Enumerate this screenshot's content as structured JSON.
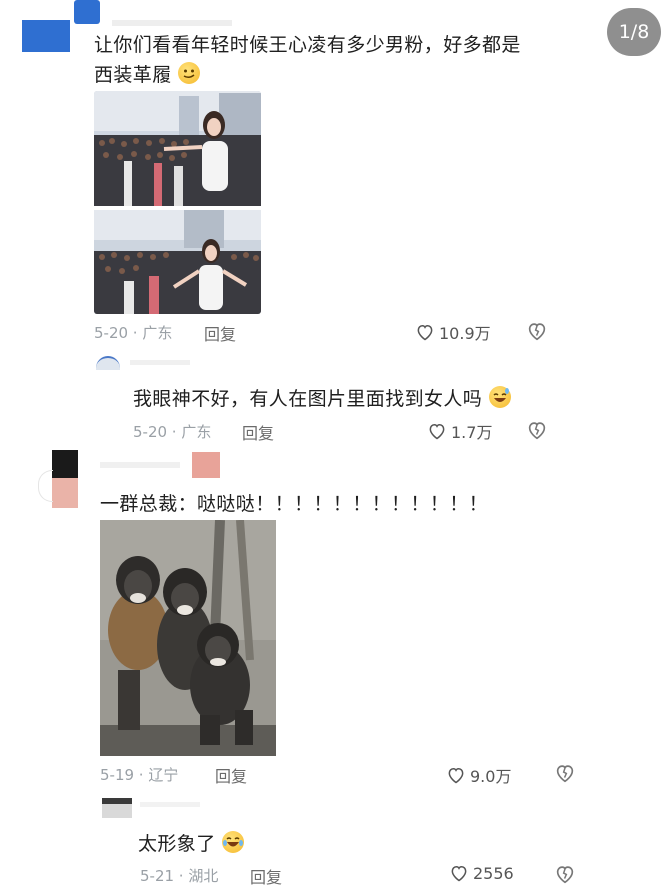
{
  "page_counter": "1/8",
  "comments": [
    {
      "text_line1": "让你们看看年轻时候王心凌有多少男粉，好多都是",
      "text_line2": "西装革履",
      "emoji": "smirk-emoji",
      "date_loc": "5-20 · 广东",
      "reply": "回复",
      "likes": "10.9万"
    },
    {
      "text": "我眼神不好，有人在图片里面找到女人吗",
      "emoji": "laughing-sweat-emoji",
      "date_loc": "5-20 · 广东",
      "reply": "回复",
      "likes": "1.7万"
    },
    {
      "text": "一群总裁：哒哒哒！！！！！！！！！！！！",
      "date_loc": "5-19 · 辽宁",
      "reply": "回复",
      "likes": "9.0万"
    },
    {
      "text": "太形象了",
      "emoji": "rolling-laughing-emoji",
      "date_loc": "5-21 · 湖北",
      "reply": "回复",
      "likes": "2556"
    }
  ],
  "colors": {
    "avatar_blue": "#2f6fd1",
    "avatar_pink": "#e8a399",
    "counter_bg": "#8f8f8f",
    "meta_gray": "#9aa0a6"
  }
}
